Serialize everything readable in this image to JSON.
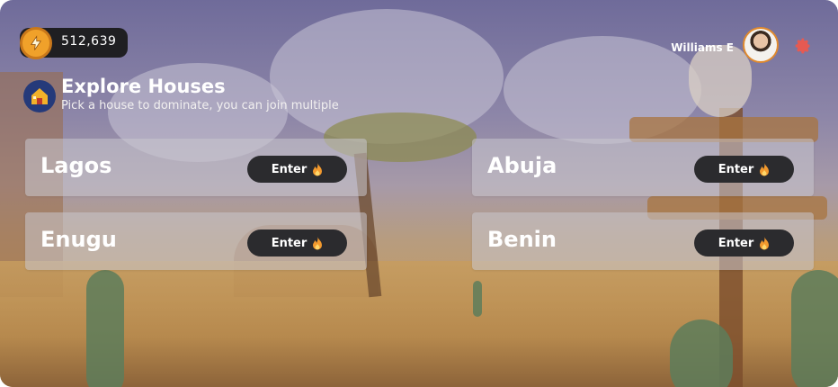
{
  "wallet": {
    "value": "512,639",
    "icon": "lightning-coin-icon"
  },
  "user": {
    "name": "Williams E",
    "avatar_icon": "avatar",
    "settings_icon": "gear-icon"
  },
  "header": {
    "title": "Explore Houses",
    "subtitle": "Pick a house to dominate, you can join multiple",
    "icon": "house-icon"
  },
  "houses": [
    {
      "name": "Lagos",
      "button": "Enter"
    },
    {
      "name": "Abuja",
      "button": "Enter"
    },
    {
      "name": "Enugu",
      "button": "Enter"
    },
    {
      "name": "Benin",
      "button": "Enter"
    }
  ],
  "colors": {
    "button_bg": "#2b2b2e",
    "coin": "#f0a12a",
    "accent": "#e08a2e"
  }
}
